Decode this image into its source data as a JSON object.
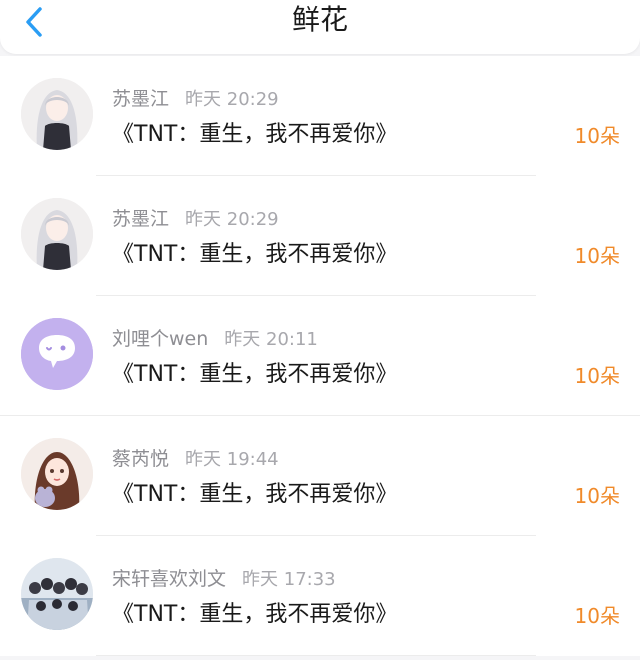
{
  "header": {
    "title": "鲜花"
  },
  "accent_color": "#f08a2a",
  "items": [
    {
      "name": "苏墨江",
      "time": "昨天 20:29",
      "book": "《TNT：重生，我不再爱你》",
      "count": "10朵",
      "avatar": "avatar-girl-white-hair"
    },
    {
      "name": "苏墨江",
      "time": "昨天 20:29",
      "book": "《TNT：重生，我不再爱你》",
      "count": "10朵",
      "avatar": "avatar-girl-white-hair"
    },
    {
      "name": "刘哩个wen",
      "time": "昨天 20:11",
      "book": "《TNT：重生，我不再爱你》",
      "count": "10朵",
      "avatar": "avatar-purple-chat"
    },
    {
      "name": "蔡芮悦",
      "time": "昨天 19:44",
      "book": "《TNT：重生，我不再爱你》",
      "count": "10朵",
      "avatar": "avatar-girl-bear"
    },
    {
      "name": "宋轩喜欢刘文",
      "time": "昨天 17:33",
      "book": "《TNT：重生，我不再爱你》",
      "count": "10朵",
      "avatar": "avatar-group-photo"
    }
  ]
}
